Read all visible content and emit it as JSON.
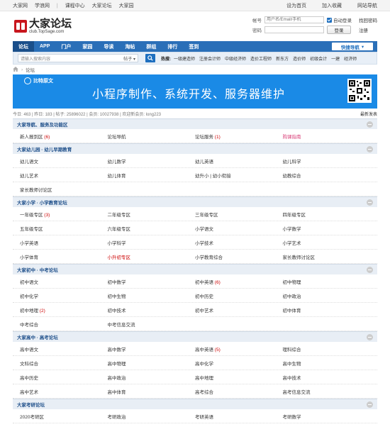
{
  "topbar": {
    "left": [
      "大家网",
      "学浪网",
      "课程中心",
      "大家论坛",
      "大家园"
    ],
    "right": [
      "设为首页",
      "加入收藏",
      "网站导航"
    ]
  },
  "logo": {
    "title": "大家论坛",
    "subtitle": "club.TopSage.com"
  },
  "login": {
    "account_label": "帐号",
    "account_placeholder": "用户名/Email/手机",
    "auto_login": "自动登录",
    "forgot": "找回密码",
    "password_label": "密码",
    "login_button": "登录",
    "register": "注册"
  },
  "nav": {
    "items": [
      "论坛",
      "APP",
      "门户",
      "家园",
      "导读",
      "淘帖",
      "群组",
      "排行",
      "签到"
    ],
    "quick": "快捷导航"
  },
  "search": {
    "placeholder": "请输入搜索内容",
    "scope": "帖子",
    "hot_label": "热搜:",
    "hot": [
      "一级建造师",
      "注册会计师",
      "中级经济师",
      "造价工程师",
      "新东方",
      "造价师",
      "初级会计",
      "一建",
      "经济师"
    ]
  },
  "breadcrumb": {
    "current": "论坛"
  },
  "banner": {
    "brand": "比特原文",
    "text": "小程序制作、系统开发、服务器维护"
  },
  "stats": {
    "text": "今日: 463  |  昨日: 183  |  帖子: 25896022  |  会员: 10027938  |  欢迎新会员: long223",
    "new_post": "最新发表"
  },
  "categories": [
    {
      "title": "大家导航、服务及功能区",
      "rows": [
        [
          {
            "name": "新人报到区",
            "count": "(6)"
          },
          {
            "name": "论坛导航"
          },
          {
            "name": "论坛服务",
            "count": "(1)"
          },
          {
            "name": "购课指南",
            "style": "pink"
          }
        ]
      ]
    },
    {
      "title": "大家幼儿园 · 幼儿早期教育",
      "rows": [
        [
          {
            "name": "幼儿语文"
          },
          {
            "name": "幼儿数学"
          },
          {
            "name": "幼儿英语"
          },
          {
            "name": "幼儿科学"
          }
        ],
        [
          {
            "name": "幼儿艺术"
          },
          {
            "name": "幼儿体育"
          },
          {
            "name": "幼升小 | 幼小衔接"
          },
          {
            "name": "幼教综合"
          }
        ],
        [
          {
            "name": "家长教师讨论区"
          }
        ]
      ]
    },
    {
      "title": "大家小学 · 小学教育论坛",
      "rows": [
        [
          {
            "name": "一年级专区",
            "count": "(3)"
          },
          {
            "name": "二年级专区"
          },
          {
            "name": "三年级专区"
          },
          {
            "name": "四年级专区"
          }
        ],
        [
          {
            "name": "五年级专区"
          },
          {
            "name": "六年级专区"
          },
          {
            "name": "小学语文"
          },
          {
            "name": "小学数学"
          }
        ],
        [
          {
            "name": "小学英语"
          },
          {
            "name": "小学科学"
          },
          {
            "name": "小学技术"
          },
          {
            "name": "小学艺术"
          }
        ],
        [
          {
            "name": "小学体育"
          },
          {
            "name": "小升初专区",
            "style": "red"
          },
          {
            "name": "小学教育综合"
          },
          {
            "name": "家长教师讨论区"
          }
        ]
      ]
    },
    {
      "title": "大家初中 · 中考论坛",
      "rows": [
        [
          {
            "name": "初中语文"
          },
          {
            "name": "初中数学"
          },
          {
            "name": "初中英语",
            "count": "(6)"
          },
          {
            "name": "初中物理"
          }
        ],
        [
          {
            "name": "初中化学"
          },
          {
            "name": "初中生物"
          },
          {
            "name": "初中历史"
          },
          {
            "name": "初中政治"
          }
        ],
        [
          {
            "name": "初中地理",
            "count": "(2)"
          },
          {
            "name": "初中技术"
          },
          {
            "name": "初中艺术"
          },
          {
            "name": "初中体育"
          }
        ],
        [
          {
            "name": "中考综合"
          },
          {
            "name": "中考信息交流"
          }
        ]
      ]
    },
    {
      "title": "大家高中 · 高考论坛",
      "rows": [
        [
          {
            "name": "高中语文"
          },
          {
            "name": "高中数学"
          },
          {
            "name": "高中英语",
            "count": "(5)"
          },
          {
            "name": "理科综合"
          }
        ],
        [
          {
            "name": "文科综合"
          },
          {
            "name": "高中物理"
          },
          {
            "name": "高中化学"
          },
          {
            "name": "高中生物"
          }
        ],
        [
          {
            "name": "高中历史"
          },
          {
            "name": "高中政治"
          },
          {
            "name": "高中地理"
          },
          {
            "name": "高中技术"
          }
        ],
        [
          {
            "name": "高中艺术"
          },
          {
            "name": "高中体育"
          },
          {
            "name": "高考综合"
          },
          {
            "name": "高考信息交流"
          }
        ]
      ]
    },
    {
      "title": "大家考研论坛",
      "rows": [
        [
          {
            "name": "2020考研区"
          },
          {
            "name": "考研政治"
          },
          {
            "name": "考研英语"
          },
          {
            "name": "考研数学"
          }
        ]
      ]
    }
  ]
}
